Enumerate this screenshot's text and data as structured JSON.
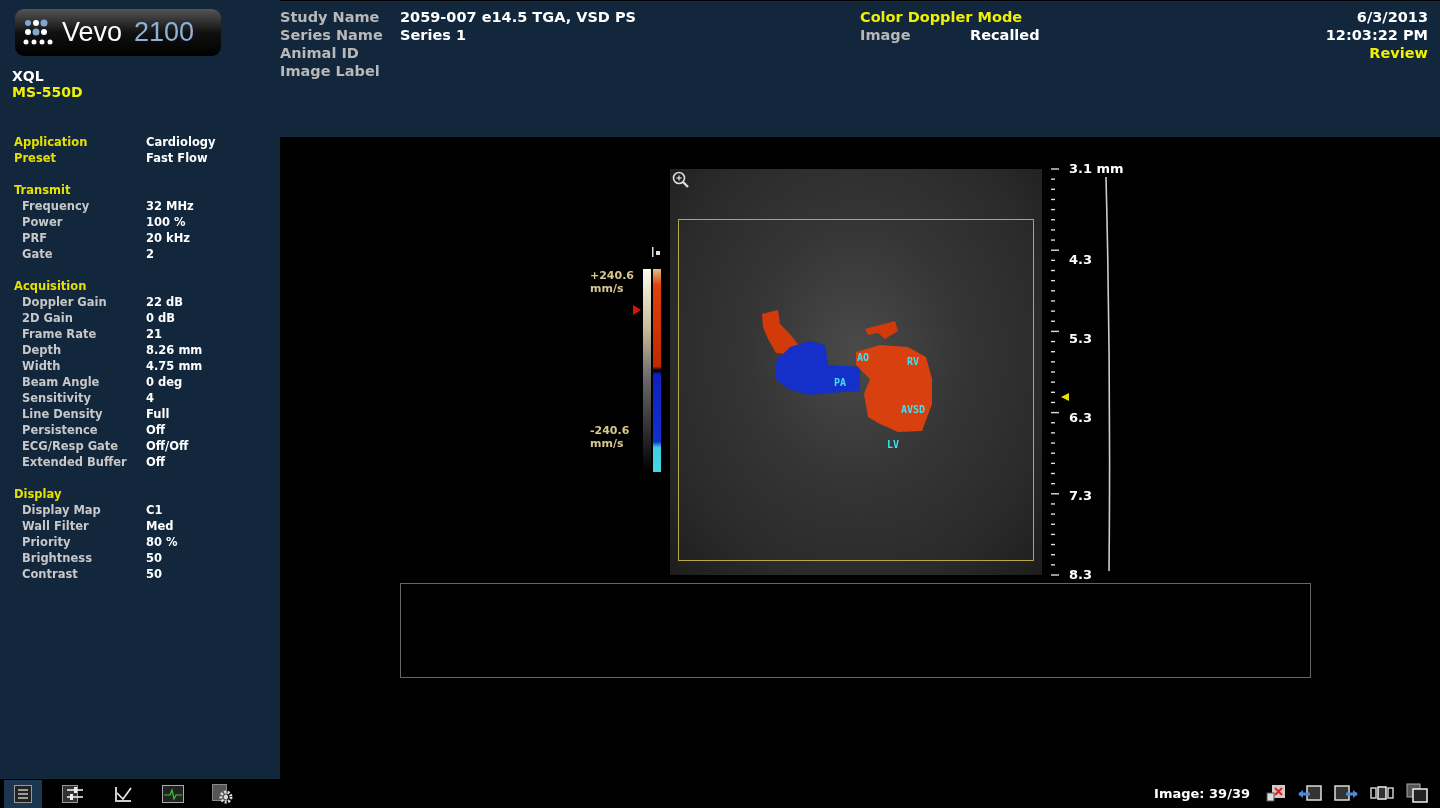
{
  "logo": {
    "brand": "Vevo",
    "model": "2100"
  },
  "system": {
    "name": "XQL",
    "probe": "MS-550D"
  },
  "settings_top": [
    {
      "label": "Application",
      "value": "Cardiology"
    },
    {
      "label": "Preset",
      "value": "Fast Flow"
    }
  ],
  "settings_sections": [
    {
      "title": "Transmit",
      "items": [
        {
          "label": "Frequency",
          "value": "32 MHz"
        },
        {
          "label": "Power",
          "value": "100 %"
        },
        {
          "label": "PRF",
          "value": "20 kHz"
        },
        {
          "label": "Gate",
          "value": "2"
        }
      ]
    },
    {
      "title": "Acquisition",
      "items": [
        {
          "label": "Doppler Gain",
          "value": "22 dB"
        },
        {
          "label": "2D Gain",
          "value": "0 dB"
        },
        {
          "label": "Frame Rate",
          "value": "21"
        },
        {
          "label": "Depth",
          "value": "8.26 mm"
        },
        {
          "label": "Width",
          "value": "4.75 mm"
        },
        {
          "label": "Beam Angle",
          "value": "0 deg"
        },
        {
          "label": "Sensitivity",
          "value": "4"
        },
        {
          "label": "Line Density",
          "value": "Full"
        },
        {
          "label": "Persistence",
          "value": "Off"
        },
        {
          "label": "ECG/Resp Gate",
          "value": "Off/Off"
        },
        {
          "label": "Extended Buffer",
          "value": "Off"
        }
      ]
    },
    {
      "title": "Display",
      "items": [
        {
          "label": "Display Map",
          "value": "C1"
        },
        {
          "label": "Wall Filter",
          "value": "Med"
        },
        {
          "label": "Priority",
          "value": "80 %"
        },
        {
          "label": "Brightness",
          "value": "50"
        },
        {
          "label": "Contrast",
          "value": "50"
        }
      ]
    }
  ],
  "header": {
    "fields": [
      {
        "label": "Study Name",
        "value": "2059-007 e14.5 TGA, VSD PS"
      },
      {
        "label": "Series Name",
        "value": "Series 1"
      },
      {
        "label": "Animal ID"
      },
      {
        "label": "Image Label"
      }
    ],
    "mode": "Color Doppler Mode",
    "image_label": "Image",
    "image_value": "Recalled",
    "date": "6/3/2013",
    "time": "12:03:22 PM",
    "status": "Review"
  },
  "viewer": {
    "scale_max": [
      "+240.6",
      "mm/s"
    ],
    "scale_min": [
      "-240.6",
      "mm/s"
    ],
    "depth_labels": [
      "3.1 mm",
      "4.3",
      "5.3",
      "6.3",
      "7.3",
      "8.3"
    ],
    "annotations": [
      "AO",
      "RV",
      "PA",
      "AVSD",
      "LV"
    ]
  },
  "toolbar": [
    {
      "selected": true
    },
    {
      "selected": false
    },
    {
      "selected": false
    },
    {
      "selected": false
    },
    {
      "selected": false
    }
  ],
  "image_counter": "Image: 39/39"
}
